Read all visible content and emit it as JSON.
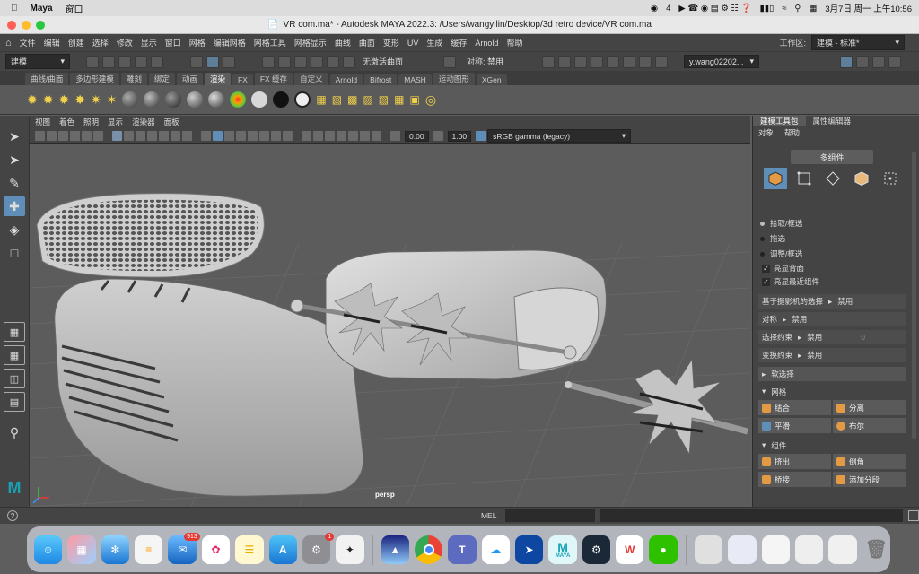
{
  "mac_menubar": {
    "app": "Maya",
    "menu": "窗口",
    "badge_wechat": "4",
    "date_time": "3月7日 周一 上午10:56"
  },
  "window": {
    "title": "VR com.ma* - Autodesk MAYA 2022.3: /Users/wangyilin/Desktop/3d retro device/VR com.ma"
  },
  "main_menu": {
    "items": [
      "文件",
      "编辑",
      "创建",
      "选择",
      "修改",
      "显示",
      "窗口",
      "网格",
      "编辑网格",
      "网格工具",
      "网格显示",
      "曲线",
      "曲面",
      "变形",
      "UV",
      "生成",
      "缓存",
      "Arnold",
      "帮助"
    ],
    "workspace_label": "工作区:",
    "workspace_value": "建模 - 标准*"
  },
  "status_line": {
    "mode": "建模",
    "no_active_surface": "无激活曲面",
    "symmetry": "对称: 禁用",
    "user": "y.wang02202..."
  },
  "shelf": {
    "tabs": [
      "曲线/曲面",
      "多边形建模",
      "雕刻",
      "绑定",
      "动画",
      "渲染",
      "FX",
      "FX 缓存",
      "自定义",
      "Arnold",
      "Bifrost",
      "MASH",
      "运动图形",
      "XGen"
    ],
    "active_tab": "渲染"
  },
  "viewport": {
    "menu": [
      "视图",
      "着色",
      "照明",
      "显示",
      "渲染器",
      "面板"
    ],
    "exposure": "0.00",
    "gamma": "1.00",
    "color_space": "sRGB gamma (legacy)",
    "camera": "persp"
  },
  "right_panel": {
    "tabs": [
      "建模工具包",
      "属性编辑器"
    ],
    "subtabs": [
      "对象",
      "帮助"
    ],
    "multi_component": "多组件",
    "selection_modes": [
      "拾取/框选",
      "拖选",
      "调整/框选"
    ],
    "checks": [
      "亮显背面",
      "亮显最近组件"
    ],
    "camera_based": {
      "label": "基于摄影机的选择",
      "value": "禁用"
    },
    "symmetry": {
      "label": "对称",
      "value": "禁用"
    },
    "select_constraint": {
      "label": "选择约束",
      "value": "禁用",
      "num": "0"
    },
    "transform_constraint": {
      "label": "变换约束",
      "value": "禁用"
    },
    "soft_select": "软选择",
    "mesh_section": "网格",
    "mesh_buttons": [
      "结合",
      "分离",
      "平滑",
      "布尔"
    ],
    "component_section": "组件",
    "component_buttons": [
      "挤出",
      "倒角",
      "桥接",
      "添加分段"
    ]
  },
  "command_line": {
    "label": "MEL"
  },
  "dock": {
    "mail_badge": "913",
    "settings_badge": "1",
    "maya_label": "MAYA",
    "word_label": "W"
  },
  "colors": {
    "accent": "#5f8fb8",
    "maya_teal": "#17a2b8",
    "menubar": "#dcdcdc"
  }
}
